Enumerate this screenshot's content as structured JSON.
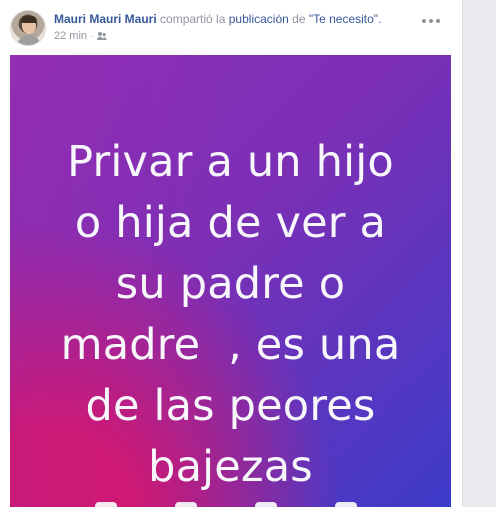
{
  "post": {
    "author": "Mauri Mauri Mauri",
    "verb": "compartió la",
    "object": "publicación",
    "preposition": "de",
    "source": "\"Te necesito\".",
    "time": "22 min",
    "separator": "·",
    "audience_icon": "friends-icon",
    "menu_icon": "more-options-icon",
    "image_lines": [
      "Privar a un hijo",
      "o hija de ver a",
      "su padre o",
      "madre  , es una",
      "de las peores",
      "bajezas"
    ],
    "colors": {
      "link": "#365899",
      "meta": "#90949c",
      "image_gradient_start": "#8c31b9",
      "image_gradient_end": "#3c3cc9",
      "image_pink": "#d4176e"
    }
  }
}
